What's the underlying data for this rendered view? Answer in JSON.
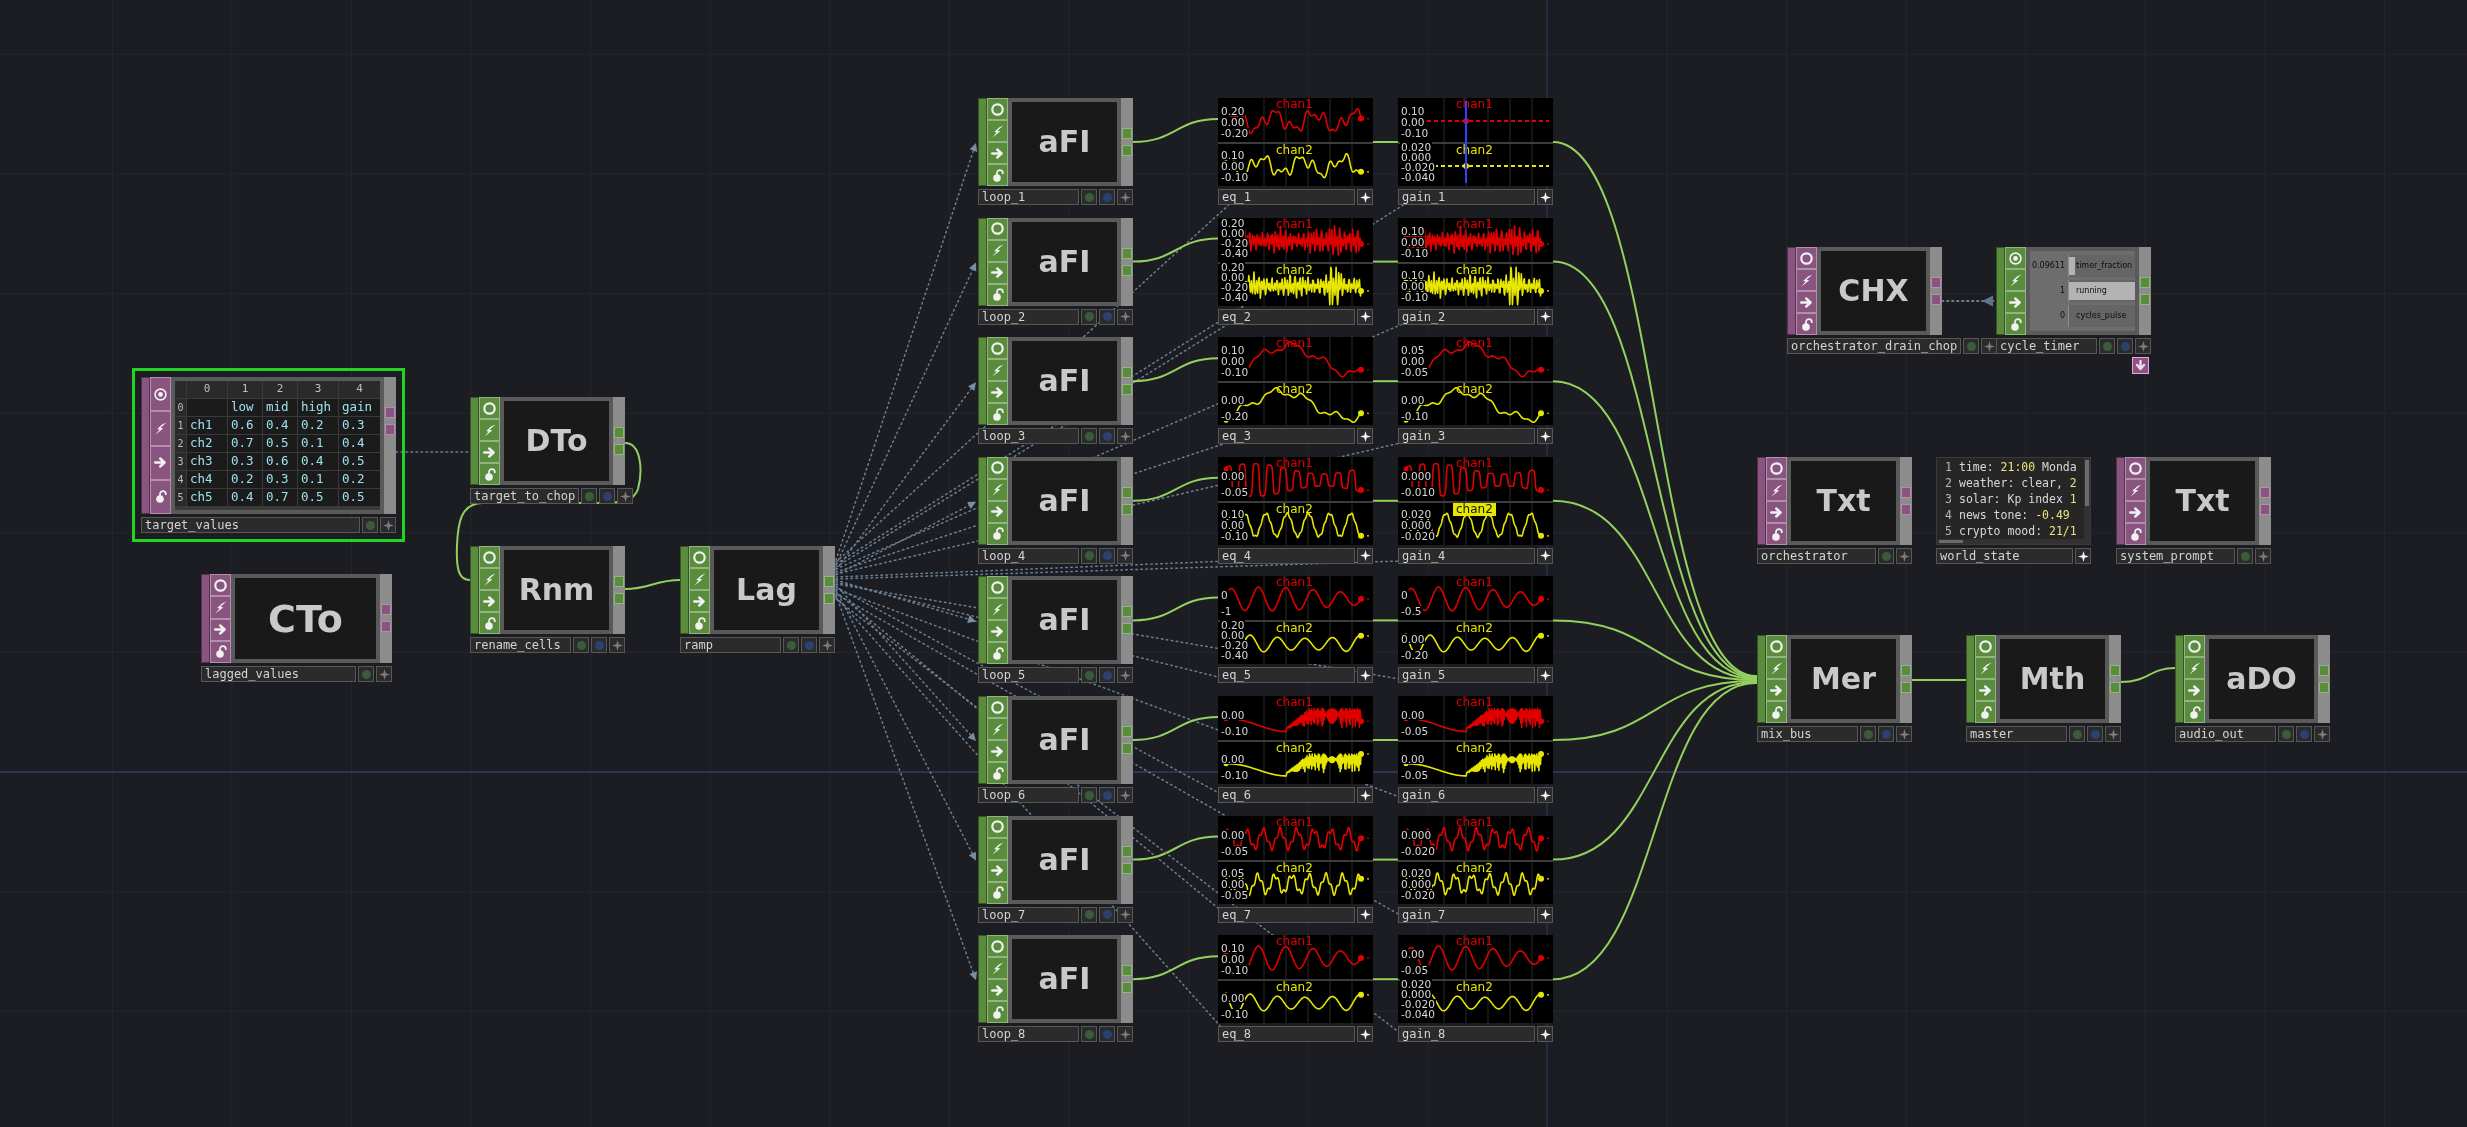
{
  "nodes": [
    {
      "kind": "table",
      "color": "#8a5480",
      "name": "target_values",
      "selected": true,
      "table": {
        "column_indices": [
          "0",
          "1",
          "2",
          "3",
          "4"
        ],
        "header": {
          "index": "0",
          "labels": [
            "low",
            "mid",
            "high",
            "gain"
          ]
        },
        "rows": [
          {
            "index": "1",
            "cells": [
              "ch1",
              "0.6",
              "0.4",
              "0.2",
              "0.3"
            ]
          },
          {
            "index": "2",
            "cells": [
              "ch2",
              "0.7",
              "0.5",
              "0.1",
              "0.4"
            ]
          },
          {
            "index": "3",
            "cells": [
              "ch3",
              "0.3",
              "0.6",
              "0.4",
              "0.5"
            ]
          },
          {
            "index": "4",
            "cells": [
              "ch4",
              "0.2",
              "0.3",
              "0.1",
              "0.2"
            ]
          },
          {
            "index": "5",
            "cells": [
              "ch5",
              "0.4",
              "0.7",
              "0.5",
              "0.5"
            ]
          }
        ]
      }
    },
    {
      "kind": "operator",
      "color": "#5a8c3d",
      "render_flag": true,
      "label": "DTo",
      "name": "target_to_chop",
      "selected": false
    },
    {
      "kind": "operator",
      "color": "#8a5480",
      "label": "CTo",
      "name": "lagged_values",
      "selected": false
    },
    {
      "kind": "operator",
      "color": "#5a8c3d",
      "render_flag": true,
      "label": "Rnm",
      "name": "rename_cells",
      "selected": false
    },
    {
      "kind": "operator",
      "color": "#5a8c3d",
      "render_flag": true,
      "label": "Lag",
      "name": "ramp",
      "selected": false
    },
    {
      "kind": "operator",
      "color": "#8a5480",
      "label": "CHX",
      "name": "orchestrator_drain_chop",
      "selected": false
    },
    {
      "kind": "channels",
      "color": "#5a8c3d",
      "render_flag": true,
      "name": "cycle_timer",
      "selected": false,
      "docked": true,
      "channels": [
        {
          "value": "0.09611",
          "name": "timer_fraction",
          "level": 0.09611
        },
        {
          "value": "1",
          "name": "running",
          "level": 1
        },
        {
          "value": "0",
          "name": "cycles_pulse",
          "level": 0
        }
      ]
    },
    {
      "kind": "operator",
      "color": "#8a5480",
      "label": "Txt",
      "name": "orchestrator",
      "selected": false
    },
    {
      "kind": "text",
      "name": "world_state",
      "selected": false,
      "lines": [
        {
          "number": "1",
          "segments": [
            {
              "kind": "plain",
              "text": "time: "
            },
            {
              "kind": "value",
              "text": "21:00"
            },
            {
              "kind": "plain",
              "text": " Monda"
            }
          ]
        },
        {
          "number": "2",
          "segments": [
            {
              "kind": "plain",
              "text": "weather: clear, "
            },
            {
              "kind": "value",
              "text": "2"
            }
          ]
        },
        {
          "number": "3",
          "segments": [
            {
              "kind": "plain",
              "text": "solar: Kp index "
            },
            {
              "kind": "value",
              "text": "1"
            }
          ]
        },
        {
          "number": "4",
          "segments": [
            {
              "kind": "plain",
              "text": "news tone: "
            },
            {
              "kind": "value",
              "text": "-0.49"
            }
          ]
        },
        {
          "number": "5",
          "segments": [
            {
              "kind": "plain",
              "text": "crypto mood: "
            },
            {
              "kind": "value",
              "text": "21/1"
            }
          ]
        }
      ]
    },
    {
      "kind": "operator",
      "color": "#8a5480",
      "label": "Txt",
      "name": "system_prompt",
      "selected": false
    },
    {
      "kind": "operator",
      "color": "#5a8c3d",
      "render_flag": true,
      "label": "Mer",
      "name": "mix_bus",
      "selected": false
    },
    {
      "kind": "operator",
      "color": "#5a8c3d",
      "render_flag": true,
      "label": "Mth",
      "name": "master",
      "selected": false
    },
    {
      "kind": "operator",
      "color": "#5a8c3d",
      "render_flag": true,
      "label": "aDO",
      "name": "audio_out",
      "selected": false
    }
  ],
  "strips": [
    {
      "loop": {
        "kind": "operator",
        "color": "#5a8c3d",
        "render_flag": true,
        "label": "aFI",
        "name": "loop_1",
        "selected": false
      },
      "eq": {
        "name": "eq_1",
        "kind": "noise",
        "cursor": false,
        "channels": [
          {
            "name": "chan1",
            "color": "#e00000",
            "highlighted": false,
            "ticks": [
              "0.20",
              "0.00",
              "-0.20"
            ]
          },
          {
            "name": "chan2",
            "color": "#e6e600",
            "highlighted": false,
            "ticks": [
              "0.10",
              "0.00",
              "-0.10"
            ]
          }
        ]
      },
      "gain": {
        "name": "gain_1",
        "kind": "flat",
        "cursor": true,
        "channels": [
          {
            "name": "chan1",
            "color": "#e00000",
            "highlighted": false,
            "ticks": [
              "0.10",
              "0.00",
              "-0.10"
            ]
          },
          {
            "name": "chan2",
            "color": "#e6e600",
            "highlighted": false,
            "ticks": [
              "0.020",
              "0.000",
              "-0.020",
              "-0.040"
            ]
          }
        ]
      }
    },
    {
      "loop": {
        "kind": "operator",
        "color": "#5a8c3d",
        "render_flag": true,
        "label": "aFI",
        "name": "loop_2",
        "selected": false
      },
      "eq": {
        "name": "eq_2",
        "kind": "dense",
        "cursor": false,
        "channels": [
          {
            "name": "chan1",
            "color": "#e00000",
            "highlighted": false,
            "ticks": [
              "0.20",
              "0.00",
              "-0.20",
              "-0.40"
            ]
          },
          {
            "name": "chan2",
            "color": "#e6e600",
            "highlighted": false,
            "ticks": [
              "0.20",
              "0.00",
              "-0.20",
              "-0.40"
            ]
          }
        ]
      },
      "gain": {
        "name": "gain_2",
        "kind": "dense",
        "cursor": false,
        "channels": [
          {
            "name": "chan1",
            "color": "#e00000",
            "highlighted": false,
            "ticks": [
              "0.10",
              "0.00",
              "-0.10"
            ]
          },
          {
            "name": "chan2",
            "color": "#e6e600",
            "highlighted": false,
            "ticks": [
              "0.10",
              "0.00",
              "-0.10"
            ]
          }
        ]
      }
    },
    {
      "loop": {
        "kind": "operator",
        "color": "#5a8c3d",
        "render_flag": true,
        "label": "aFI",
        "name": "loop_3",
        "selected": false
      },
      "eq": {
        "name": "eq_3",
        "kind": "slow",
        "cursor": false,
        "channels": [
          {
            "name": "chan1",
            "color": "#e00000",
            "highlighted": false,
            "ticks": [
              "0.10",
              "0.00",
              "-0.10"
            ]
          },
          {
            "name": "chan2",
            "color": "#e6e600",
            "highlighted": false,
            "ticks": [
              "0.00",
              "-0.20"
            ]
          }
        ]
      },
      "gain": {
        "name": "gain_3",
        "kind": "slow",
        "cursor": false,
        "channels": [
          {
            "name": "chan1",
            "color": "#e00000",
            "highlighted": false,
            "ticks": [
              "0.05",
              "0.00",
              "-0.05"
            ]
          },
          {
            "name": "chan2",
            "color": "#e6e600",
            "highlighted": false,
            "ticks": [
              "0.00",
              "-0.10"
            ]
          }
        ]
      }
    },
    {
      "loop": {
        "kind": "operator",
        "color": "#5a8c3d",
        "render_flag": true,
        "label": "aFI",
        "name": "loop_4",
        "selected": false
      },
      "eq": {
        "name": "eq_4",
        "kind": "burst",
        "cursor": false,
        "channels": [
          {
            "name": "chan1",
            "color": "#e00000",
            "highlighted": false,
            "ticks": [
              "0.00",
              "-0.05"
            ]
          },
          {
            "name": "chan2",
            "color": "#e6e600",
            "highlighted": false,
            "ticks": [
              "0.10",
              "0.00",
              "-0.10"
            ]
          }
        ]
      },
      "gain": {
        "name": "gain_4",
        "kind": "burst",
        "cursor": false,
        "channels": [
          {
            "name": "chan1",
            "color": "#e00000",
            "highlighted": false,
            "ticks": [
              "0.000",
              "-0.010"
            ]
          },
          {
            "name": "chan2",
            "color": "#e6e600",
            "highlighted": true,
            "ticks": [
              "0.020",
              "0.000",
              "-0.020"
            ]
          }
        ]
      }
    },
    {
      "loop": {
        "kind": "operator",
        "color": "#5a8c3d",
        "render_flag": true,
        "label": "aFI",
        "name": "loop_5",
        "selected": false
      },
      "eq": {
        "name": "eq_5",
        "kind": "sine",
        "cursor": false,
        "channels": [
          {
            "name": "chan1",
            "color": "#e00000",
            "highlighted": false,
            "ticks": [
              "0",
              "-1"
            ]
          },
          {
            "name": "chan2",
            "color": "#e6e600",
            "highlighted": false,
            "ticks": [
              "0.20",
              "0.00",
              "-0.20",
              "-0.40"
            ]
          }
        ]
      },
      "gain": {
        "name": "gain_5",
        "kind": "sine",
        "cursor": false,
        "channels": [
          {
            "name": "chan1",
            "color": "#e00000",
            "highlighted": false,
            "ticks": [
              "0",
              "-0.5"
            ]
          },
          {
            "name": "chan2",
            "color": "#e6e600",
            "highlighted": false,
            "ticks": [
              "0.00",
              "-0.20"
            ]
          }
        ]
      }
    },
    {
      "loop": {
        "kind": "operator",
        "color": "#5a8c3d",
        "render_flag": true,
        "label": "aFI",
        "name": "loop_6",
        "selected": false
      },
      "eq": {
        "name": "eq_6",
        "kind": "chirp",
        "cursor": false,
        "channels": [
          {
            "name": "chan1",
            "color": "#e00000",
            "highlighted": false,
            "ticks": [
              "0.00",
              "-0.10"
            ]
          },
          {
            "name": "chan2",
            "color": "#e6e600",
            "highlighted": false,
            "ticks": [
              "0.00",
              "-0.10"
            ]
          }
        ]
      },
      "gain": {
        "name": "gain_6",
        "kind": "chirp",
        "cursor": false,
        "channels": [
          {
            "name": "chan1",
            "color": "#e00000",
            "highlighted": false,
            "ticks": [
              "0.00",
              "-0.05"
            ]
          },
          {
            "name": "chan2",
            "color": "#e6e600",
            "highlighted": false,
            "ticks": [
              "0.00",
              "-0.05"
            ]
          }
        ]
      }
    },
    {
      "loop": {
        "kind": "operator",
        "color": "#5a8c3d",
        "render_flag": true,
        "label": "aFI",
        "name": "loop_7",
        "selected": false
      },
      "eq": {
        "name": "eq_7",
        "kind": "ripple",
        "cursor": false,
        "channels": [
          {
            "name": "chan1",
            "color": "#e00000",
            "highlighted": false,
            "ticks": [
              "0.00",
              "-0.05"
            ]
          },
          {
            "name": "chan2",
            "color": "#e6e600",
            "highlighted": false,
            "ticks": [
              "0.05",
              "0.00",
              "-0.05"
            ]
          }
        ]
      },
      "gain": {
        "name": "gain_7",
        "kind": "ripple",
        "cursor": false,
        "channels": [
          {
            "name": "chan1",
            "color": "#e00000",
            "highlighted": false,
            "ticks": [
              "0.000",
              "-0.020"
            ]
          },
          {
            "name": "chan2",
            "color": "#e6e600",
            "highlighted": false,
            "ticks": [
              "0.020",
              "0.000",
              "-0.020"
            ]
          }
        ]
      }
    },
    {
      "loop": {
        "kind": "operator",
        "color": "#5a8c3d",
        "render_flag": true,
        "label": "aFI",
        "name": "loop_8",
        "selected": false
      },
      "eq": {
        "name": "eq_8",
        "kind": "sine",
        "cursor": false,
        "channels": [
          {
            "name": "chan1",
            "color": "#e00000",
            "highlighted": false,
            "ticks": [
              "0.10",
              "0.00",
              "-0.10"
            ]
          },
          {
            "name": "chan2",
            "color": "#e6e600",
            "highlighted": false,
            "ticks": [
              "0.00",
              "-0.10"
            ]
          }
        ]
      },
      "gain": {
        "name": "gain_8",
        "kind": "sine",
        "cursor": false,
        "channels": [
          {
            "name": "chan1",
            "color": "#e00000",
            "highlighted": false,
            "ticks": [
              "0.00",
              "-0.05"
            ]
          },
          {
            "name": "chan2",
            "color": "#e6e600",
            "highlighted": false,
            "ticks": [
              "0.020",
              "0.000",
              "-0.020",
              "-0.040"
            ]
          }
        ]
      }
    }
  ]
}
